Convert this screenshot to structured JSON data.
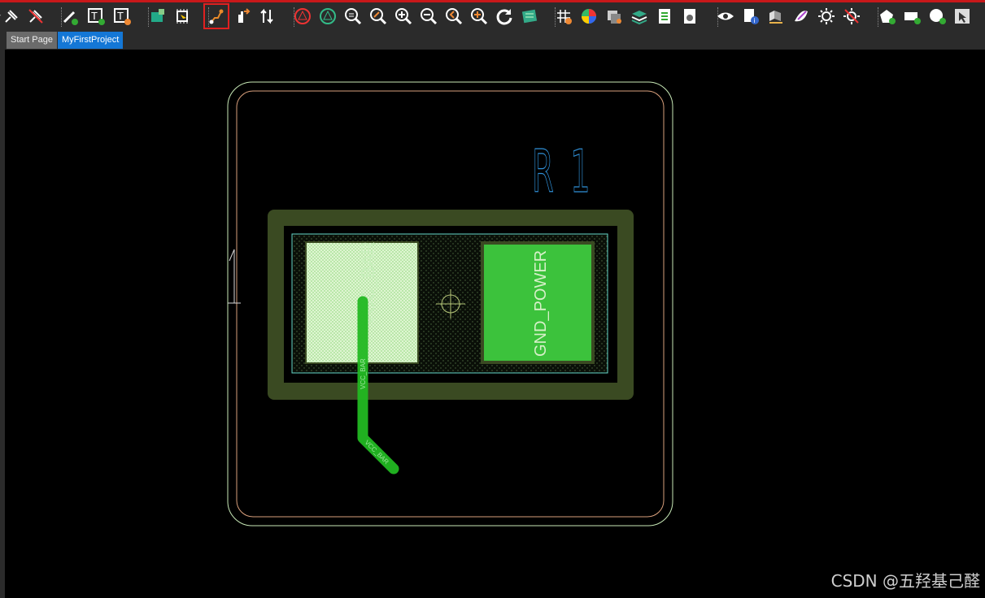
{
  "toolbar": {
    "icons": [
      "pin-icon",
      "unpin-icon",
      "place-track-icon",
      "place-text-icon",
      "text-frame-icon",
      "component-icon",
      "chip-select-icon",
      "interactive-route-icon",
      "move-icon",
      "diff-pair-icon",
      "drc-icon",
      "net-icon",
      "zoom-fit-icon",
      "zoom-area-icon",
      "zoom-in-icon",
      "zoom-out-icon",
      "zoom-previous-icon",
      "zoom-selected-icon",
      "refresh-icon",
      "board-icon",
      "grid-icon",
      "color-wheel-icon",
      "layer-set-icon",
      "layer-stack-icon",
      "report-icon",
      "settings-icon",
      "view-icon",
      "info-icon",
      "3d-body-icon",
      "mask-icon",
      "brightness-icon",
      "clear-highlight-icon",
      "add-polygon-icon",
      "add-fill-icon",
      "add-circle-icon",
      "select-icon"
    ],
    "active_icon": "interactive-route-icon"
  },
  "tabs": {
    "start_page": "Start Page",
    "project": "MyFirstProject"
  },
  "pcb": {
    "designator": "R1",
    "pad1_net": "VCC_BAR",
    "pad2_net": "GND_POWER",
    "trace_label_vertical": "VCC_BAR",
    "trace_label_diagonal": "VCC_BAR",
    "colors": {
      "background": "#000000",
      "courtyard": "#d9a07c",
      "outline": "#c7e8b6",
      "designator": "#2f8fd6",
      "solder_mask": "#3a4a22",
      "pad1": "#d6f0c8",
      "pad2": "#3cc23c",
      "trace": "#22b822"
    }
  },
  "watermark": "CSDN @五羟基己醛"
}
